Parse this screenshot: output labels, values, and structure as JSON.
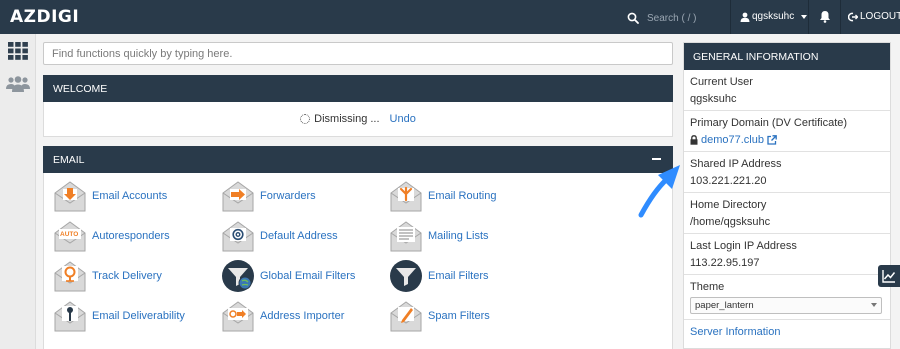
{
  "header": {
    "logo": "AZDIGI",
    "search_placeholder": "Search ( / )",
    "username": "qgsksuhc",
    "logout_label": "LOGOUT"
  },
  "main": {
    "function_search_placeholder": "Find functions quickly by typing here.",
    "welcome": {
      "title": "WELCOME",
      "dismiss_text": "Dismissing ...",
      "undo_label": "Undo"
    },
    "email": {
      "title": "EMAIL",
      "items": [
        {
          "label": "Email Accounts",
          "icon": "email-accounts-icon"
        },
        {
          "label": "Forwarders",
          "icon": "forwarders-icon"
        },
        {
          "label": "Email Routing",
          "icon": "email-routing-icon"
        },
        {
          "label": "Autoresponders",
          "icon": "autoresponders-icon"
        },
        {
          "label": "Default Address",
          "icon": "default-address-icon"
        },
        {
          "label": "Mailing Lists",
          "icon": "mailing-lists-icon"
        },
        {
          "label": "Track Delivery",
          "icon": "track-delivery-icon"
        },
        {
          "label": "Global Email Filters",
          "icon": "global-email-filters-icon"
        },
        {
          "label": "Email Filters",
          "icon": "email-filters-icon"
        },
        {
          "label": "Email Deliverability",
          "icon": "email-deliverability-icon"
        },
        {
          "label": "Address Importer",
          "icon": "address-importer-icon"
        },
        {
          "label": "Spam Filters",
          "icon": "spam-filters-icon"
        }
      ],
      "autoresponder_badge": "AUTO"
    }
  },
  "sidebar": {
    "title": "GENERAL INFORMATION",
    "current_user_label": "Current User",
    "current_user": "qgsksuhc",
    "primary_domain_label": "Primary Domain (DV Certificate)",
    "primary_domain": "demo77.club",
    "shared_ip_label": "Shared IP Address",
    "shared_ip": "103.221.221.20",
    "home_dir_label": "Home Directory",
    "home_dir": "/home/qgsksuhc",
    "last_login_label": "Last Login IP Address",
    "last_login_ip": "113.22.95.197",
    "theme_label": "Theme",
    "theme_value": "paper_lantern",
    "server_info_label": "Server Information"
  },
  "colors": {
    "navbar": "#293a4a",
    "link": "#2a72c0",
    "accent_orange": "#f07f25",
    "annotation_arrow": "#2f8cff"
  }
}
